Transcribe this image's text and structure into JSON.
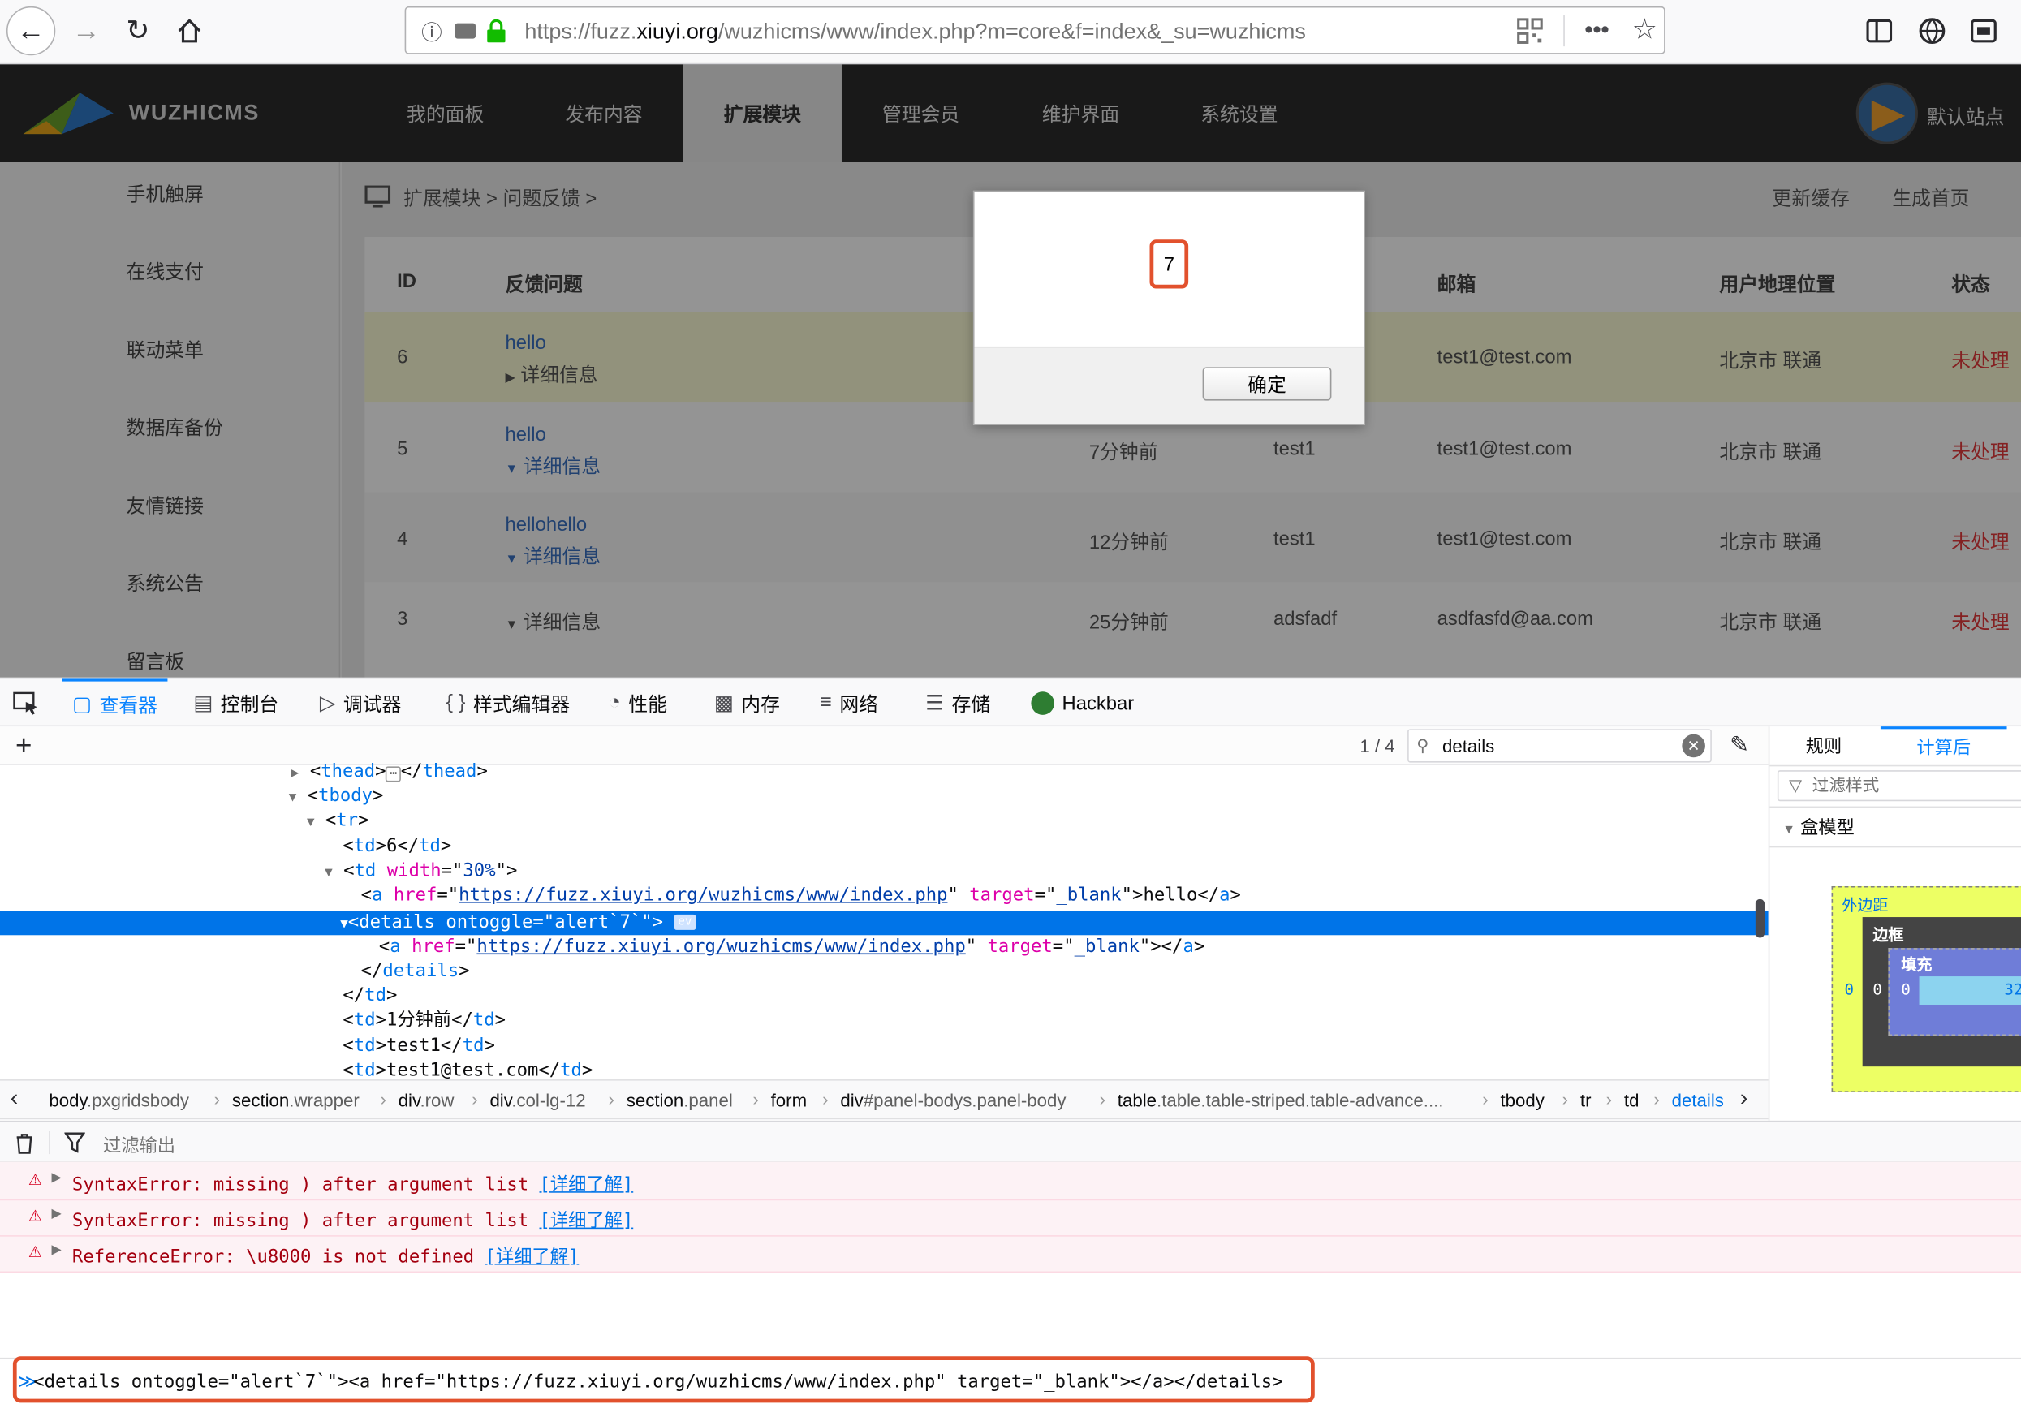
{
  "browser": {
    "url_prefix": "https://fuzz.",
    "url_domain": "xiuyi.org",
    "url_suffix": "/wuzhicms/www/index.php?m=core&f=index&_su=wuzhicms"
  },
  "cms": {
    "logo_text": "WUZHICMS",
    "menu": [
      {
        "label": "我的面板"
      },
      {
        "label": "发布内容"
      },
      {
        "label": "扩展模块"
      },
      {
        "label": "管理会员"
      },
      {
        "label": "维护界面"
      },
      {
        "label": "系统设置"
      }
    ],
    "site_name": "默认站点",
    "sidebar": [
      "手机触屏",
      "在线支付",
      "联动菜单",
      "数据库备份",
      "友情链接",
      "系统公告",
      "留言板"
    ],
    "breadcrumb": "扩展模块 > 问题反馈 >",
    "top_buttons": [
      "更新缓存",
      "生成首页"
    ],
    "table": {
      "headers": [
        "ID",
        "反馈问题",
        "邮箱",
        "用户地理位置",
        "状态"
      ],
      "rows": [
        {
          "id": "6",
          "title": "hello",
          "detail": "详细信息",
          "time": "",
          "user": "",
          "email": "test1@test.com",
          "location": "北京市 联通",
          "status": "未处理"
        },
        {
          "id": "5",
          "title": "hello",
          "detail": "详细信息",
          "time": "7分钟前",
          "user": "test1",
          "email": "test1@test.com",
          "location": "北京市 联通",
          "status": "未处理"
        },
        {
          "id": "4",
          "title": "hellohello",
          "detail": "详细信息",
          "time": "12分钟前",
          "user": "test1",
          "email": "test1@test.com",
          "location": "北京市 联通",
          "status": "未处理"
        },
        {
          "id": "3",
          "title": "",
          "detail": "详细信息",
          "time": "25分钟前",
          "user": "adsfadf",
          "email": "asdfasfd@aa.com",
          "location": "北京市 联通",
          "status": "未处理"
        }
      ]
    }
  },
  "dialog": {
    "message": "7",
    "ok_label": "确定"
  },
  "devtools": {
    "tabs": [
      "查看器",
      "控制台",
      "调试器",
      "样式编辑器",
      "性能",
      "内存",
      "网络",
      "存储",
      "Hackbar"
    ],
    "search_count": "1 / 4",
    "search_value": "details",
    "breadcrumbs": [
      {
        "tag": "body",
        "cls": ".pxgridsbody"
      },
      {
        "tag": "section",
        "cls": ".wrapper"
      },
      {
        "tag": "div",
        "cls": ".row"
      },
      {
        "tag": "div",
        "cls": ".col-lg-12"
      },
      {
        "tag": "section",
        "cls": ".panel"
      },
      {
        "tag": "form",
        "cls": ""
      },
      {
        "tag": "div",
        "cls": "#panel-bodys.panel-body"
      },
      {
        "tag": "table",
        "cls": ".table.table-striped.table-advance...."
      },
      {
        "tag": "tbody",
        "cls": ""
      },
      {
        "tag": "tr",
        "cls": ""
      },
      {
        "tag": "td",
        "cls": ""
      },
      {
        "tag": "details",
        "cls": ""
      }
    ],
    "side_tabs": [
      "规则",
      "计算后"
    ],
    "filter_styles_placeholder": "过滤样式",
    "box_model_title": "盒模型",
    "box_model": {
      "margin_label": "外边距",
      "border_label": "边框",
      "padding_label": "填充",
      "margin": "0",
      "border": "0",
      "padding": "0",
      "content": "32"
    },
    "console_filter_placeholder": "过滤输出",
    "console_messages": [
      {
        "text": "SyntaxError: missing ) after argument list",
        "link": "[详细了解]"
      },
      {
        "text": "SyntaxError: missing ) after argument list",
        "link": "[详细了解]"
      },
      {
        "text": "ReferenceError: \\u8000 is not defined",
        "link": "[详细了解]"
      }
    ],
    "console_input": "<details ontoggle=\"alert`7`\"><a href=\"https://fuzz.xiuyi.org/wuzhicms/www/index.php\" target=\"_blank\"></a></details>",
    "markup": {
      "l0_tag": "thead",
      "l1_tag": "tbody",
      "l2_tag": "tr",
      "l3_text": "6",
      "l4_attr": "width",
      "l4_val": "30%",
      "href": "https://fuzz.xiuyi.org/wuzhicms/www/index.php",
      "target": "_blank",
      "l5_text": "hello",
      "l6_attr": "ontoggle",
      "l6_val": "alert`7`",
      "ev_badge": "ev",
      "l10_text": "1分钟前",
      "l11_text": "test1",
      "l12_text": "test1@test.com"
    }
  }
}
